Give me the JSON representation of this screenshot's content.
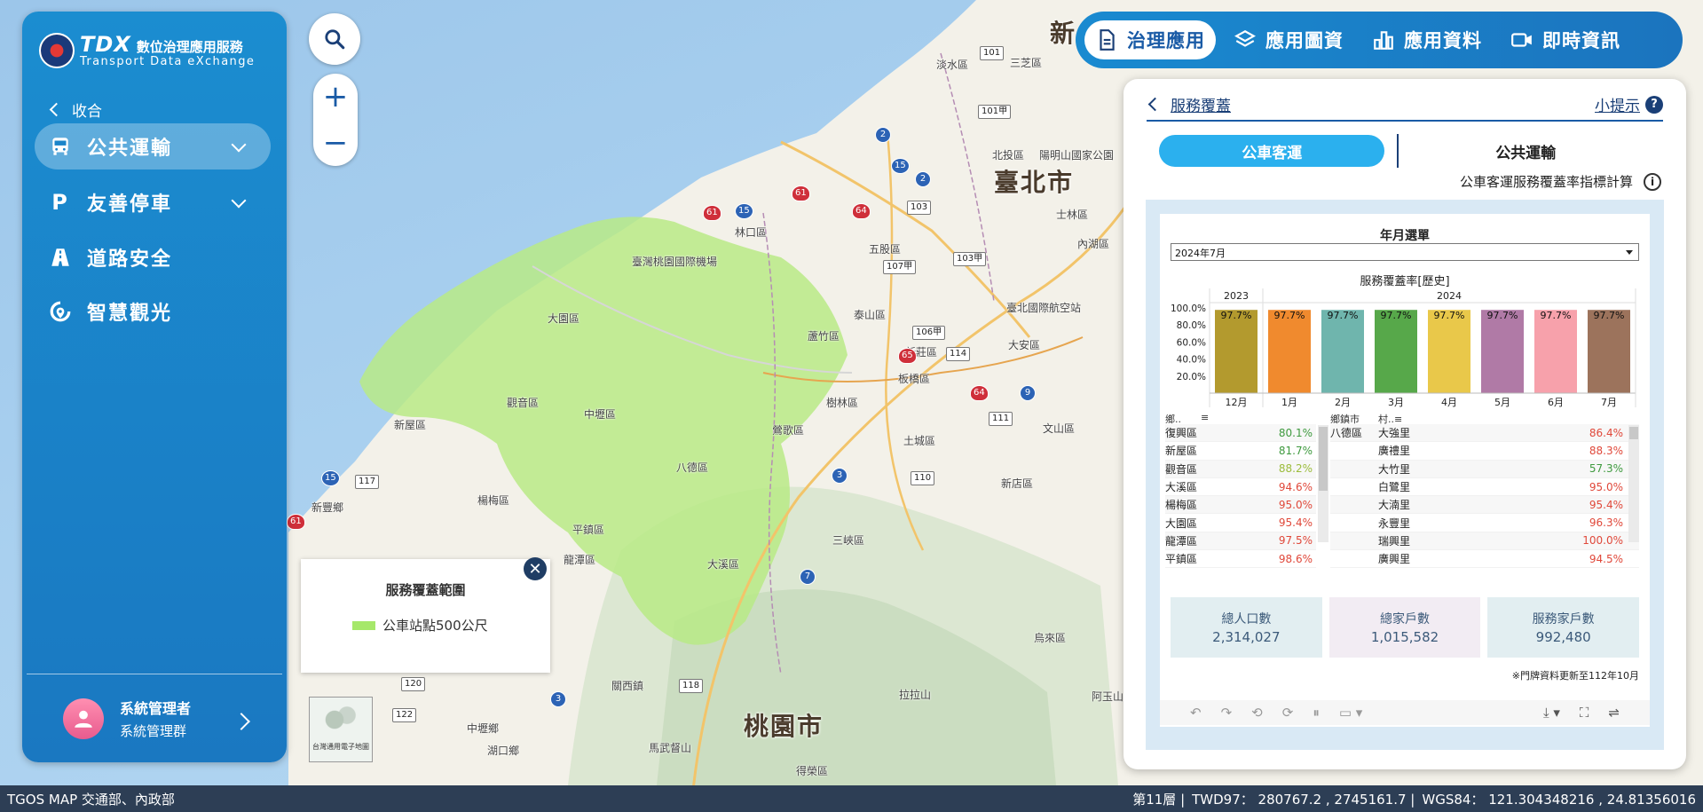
{
  "brand": {
    "logo_text": "TDX",
    "title": "數位治理應用服務",
    "subtitle": "Transport Data eXchange"
  },
  "sidebar": {
    "collapse_label": "收合",
    "items": [
      {
        "label": "公共運輸",
        "icon": "bus-icon"
      },
      {
        "label": "友善停車",
        "icon": "parking-icon"
      },
      {
        "label": "道路安全",
        "icon": "road-icon"
      },
      {
        "label": "智慧觀光",
        "icon": "tourism-icon"
      }
    ],
    "user": {
      "name": "系統管理者",
      "group": "系統管理群"
    }
  },
  "top_tabs": [
    {
      "label": "治理應用",
      "icon": "document-icon"
    },
    {
      "label": "應用圖資",
      "icon": "layers-icon"
    },
    {
      "label": "應用資料",
      "icon": "bar-chart-icon"
    },
    {
      "label": "即時資訊",
      "icon": "video-icon"
    }
  ],
  "panel": {
    "back_label": "服務覆蓋",
    "tip_label": "小提示",
    "subtabs": [
      "公車客運",
      "公共運輸"
    ],
    "calc_label": "公車客運服務覆蓋率指標計算",
    "year_month_title": "年月選單",
    "year_month_value": "2024年7月",
    "chart_title": "服務覆蓋率[歷史]",
    "left_table": {
      "headers": [
        "鄉..",
        "≡"
      ],
      "rows": [
        {
          "name": "復興區",
          "pct": "80.1%",
          "color": "#3f9a3f"
        },
        {
          "name": "新屋區",
          "pct": "81.7%",
          "color": "#3f9a3f"
        },
        {
          "name": "觀音區",
          "pct": "88.2%",
          "color": "#9cbc3c"
        },
        {
          "name": "大溪區",
          "pct": "94.6%",
          "color": "#e0483a"
        },
        {
          "name": "楊梅區",
          "pct": "95.0%",
          "color": "#e0483a"
        },
        {
          "name": "大園區",
          "pct": "95.4%",
          "color": "#e0483a"
        },
        {
          "name": "龍潭區",
          "pct": "97.5%",
          "color": "#e0483a"
        },
        {
          "name": "平鎮區",
          "pct": "98.6%",
          "color": "#e0483a"
        }
      ]
    },
    "right_table": {
      "headers": [
        "鄉鎮市",
        "村..≡"
      ],
      "district": "八德區",
      "rows": [
        {
          "name": "大強里",
          "pct": "86.4%",
          "color": "#e0483a"
        },
        {
          "name": "廣禮里",
          "pct": "88.3%",
          "color": "#e0483a"
        },
        {
          "name": "大竹里",
          "pct": "57.3%",
          "color": "#3f9a3f"
        },
        {
          "name": "白鷺里",
          "pct": "95.0%",
          "color": "#e0483a"
        },
        {
          "name": "大湳里",
          "pct": "95.4%",
          "color": "#e0483a"
        },
        {
          "name": "永豐里",
          "pct": "96.3%",
          "color": "#e0483a"
        },
        {
          "name": "瑞興里",
          "pct": "100.0%",
          "color": "#e0483a"
        },
        {
          "name": "廣興里",
          "pct": "94.5%",
          "color": "#e0483a"
        }
      ]
    },
    "stats": [
      {
        "label": "總人口數",
        "value": "2,314,027",
        "bg": "#e2eef1"
      },
      {
        "label": "總家戶數",
        "value": "1,015,582",
        "bg": "#f2ecf3"
      },
      {
        "label": "服務家戶數",
        "value": "992,480",
        "bg": "#e2eef1"
      }
    ],
    "note": "※門牌資料更新至112年10月"
  },
  "chart_data": {
    "type": "bar",
    "title": "服務覆蓋率[歷史]",
    "year_groups": [
      {
        "label": "2023",
        "count": 1
      },
      {
        "label": "2024",
        "count": 7
      }
    ],
    "categories": [
      "12月",
      "1月",
      "2月",
      "3月",
      "4月",
      "5月",
      "6月",
      "7月"
    ],
    "values": [
      97.7,
      97.7,
      97.7,
      97.7,
      97.7,
      97.7,
      97.7,
      97.7
    ],
    "value_labels": [
      "97.7%",
      "97.7%",
      "97.7%",
      "97.7%",
      "97.7%",
      "97.7%",
      "97.7%",
      "97.7%"
    ],
    "colors": [
      "#b39a2e",
      "#f08a2e",
      "#6fb5ad",
      "#57a84a",
      "#e9c84a",
      "#b07aa6",
      "#f7a1ab",
      "#9c735c"
    ],
    "y_ticks": [
      "100.0%",
      "80.0%",
      "60.0%",
      "40.0%",
      "20.0%"
    ],
    "ylim": [
      0,
      100
    ]
  },
  "legend": {
    "title": "服務覆蓋範圍",
    "item": "公車站點500公尺",
    "color": "#a6e86a"
  },
  "minimap_label": "台灣通用電子地圖",
  "map_labels": {
    "cities": [
      "臺北市",
      "桃園市",
      "新"
    ],
    "places": [
      "淡水區",
      "三芝區",
      "北投區",
      "陽明山國家公園",
      "士林區",
      "內湖區",
      "五股區",
      "林口區",
      "蘆竹區",
      "泰山區",
      "新莊區",
      "大安區",
      "臺北國際航空站",
      "板橋區",
      "樹林區",
      "土城區",
      "鶯歌區",
      "新店區",
      "文山區",
      "三峽區",
      "烏來區",
      "大園區",
      "觀音區",
      "中壢區",
      "八德區",
      "楊梅區",
      "平鎮區",
      "龍潭區",
      "大溪區",
      "新屋區",
      "新豐鄉",
      "湖口鄉",
      "中壢鄉",
      "關西鎮",
      "馬武督山",
      "得榮區",
      "拉拉山",
      "阿玉山",
      "臺灣桃園國際機場"
    ]
  },
  "status": {
    "left": "TGOS MAP 交通部、內政部",
    "level": "第11層 |",
    "twd97": "TWD97： 280767.2 , 2745161.7 |",
    "wgs84": "WGS84： 121.304348216 , 24.81356016"
  }
}
